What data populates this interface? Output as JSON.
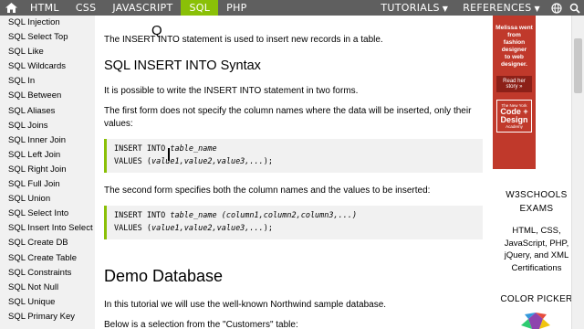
{
  "topnav": {
    "tabs": [
      "HTML",
      "CSS",
      "JAVASCRIPT",
      "SQL",
      "PHP"
    ],
    "active_tab": "SQL",
    "tutorials_label": "TUTORIALS",
    "references_label": "REFERENCES",
    "accent_color": "#8ac007",
    "icons": [
      "home-icon",
      "globe-icon",
      "search-icon"
    ]
  },
  "sidebar": {
    "items": [
      "SQL Injection",
      "SQL Select Top",
      "SQL Like",
      "SQL Wildcards",
      "SQL In",
      "SQL Between",
      "SQL Aliases",
      "SQL Joins",
      "SQL Inner Join",
      "SQL Left Join",
      "SQL Right Join",
      "SQL Full Join",
      "SQL Union",
      "SQL Select Into",
      "SQL Insert Into Select",
      "SQL Create DB",
      "SQL Create Table",
      "SQL Constraints",
      "SQL Not Null",
      "SQL Unique",
      "SQL Primary Key"
    ]
  },
  "main": {
    "intro": "The INSERT INTO statement is used to insert new records in a table.",
    "syntax_heading": "SQL INSERT INTO Syntax",
    "forms_text": "It is possible to write the INSERT INTO statement in two forms.",
    "form1_text": "The first form does not specify the column names where the data will be inserted, only their values:",
    "code1_line1_kw": "INSERT INTO ",
    "code1_line1_var": "table_name",
    "code1_line2_kw": "VALUES (",
    "code1_line2_var": "value1,value2,value3,...",
    "code1_line2_end": ");",
    "form2_text": "The second form specifies both the column names and the values to be inserted:",
    "code2_line1_kw": "INSERT INTO ",
    "code2_line1_var": "table_name (column1,column2,column3,...)",
    "code2_line2_kw": "VALUES (",
    "code2_line2_var": "value1,value2,value3,...",
    "code2_line2_end": ");",
    "demo_heading": "Demo Database",
    "demo_text": "In this tutorial we will use the well-known Northwind sample database.",
    "selection_text": "Below is a selection from the \"Customers\" table:"
  },
  "right": {
    "ad_line1": "Melissa went from",
    "ad_line2": "fashion designer",
    "ad_line3": "to web designer.",
    "ad_button": "Read her story »",
    "ad_logo_small": "The New York",
    "ad_logo_big1": "Code +",
    "ad_logo_big2": "Design",
    "ad_logo_small2": "Academy",
    "exams_title1": "W3SCHOOLS",
    "exams_title2": "EXAMS",
    "exams_desc": "HTML, CSS, JavaScript, PHP, jQuery, and XML Certifications",
    "color_picker": "COLOR PICKER",
    "ad_color": "#c0392b"
  }
}
